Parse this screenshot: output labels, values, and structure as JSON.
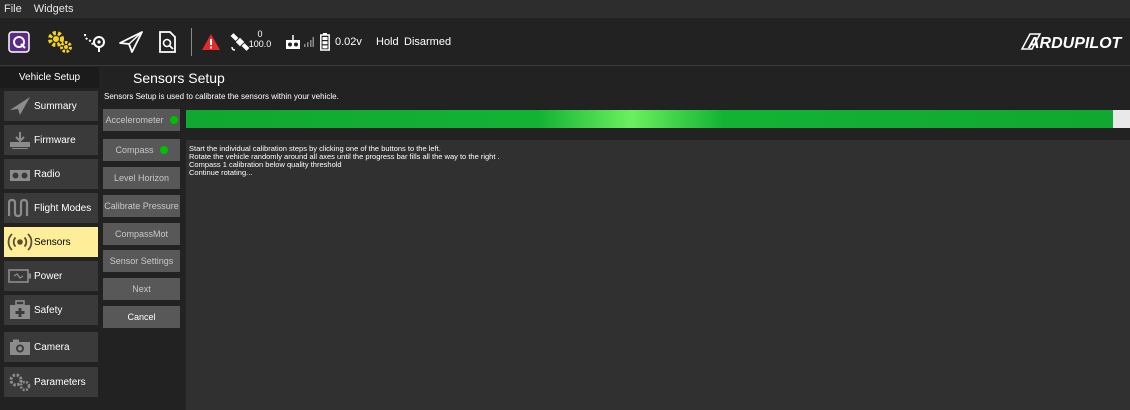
{
  "menubar": {
    "file": "File",
    "widgets": "Widgets"
  },
  "toolbar": {
    "icons": [
      "qgc-logo-icon",
      "vehicle-setup-gear-icon",
      "plan-waypoint-icon",
      "fly-paper-plane-icon",
      "analyze-document-icon",
      "warning-triangle-icon",
      "gps-satellite-icon",
      "rc-transmitter-icon",
      "battery-icon"
    ],
    "gps_count": "0",
    "gps_hdop": "100.0",
    "battery_voltage": "0.02v",
    "flight_mode": "Hold",
    "arm_status": "Disarmed",
    "brand_logo": "ARDUPILOT",
    "warning_color": "#e22a2a",
    "gear_color": "#f5d21e"
  },
  "sidebar": {
    "header": "Vehicle Setup",
    "items": [
      {
        "label": "Summary",
        "icon": "paper-plane-icon",
        "active": false
      },
      {
        "label": "Firmware",
        "icon": "firmware-download-icon",
        "active": false
      },
      {
        "label": "Radio",
        "icon": "radio-transmitter-icon",
        "active": false
      },
      {
        "label": "Flight Modes",
        "icon": "flight-modes-wave-icon",
        "active": false
      },
      {
        "label": "Sensors",
        "icon": "sensors-broadcast-icon",
        "active": true
      },
      {
        "label": "Power",
        "icon": "power-battery-icon",
        "active": false
      },
      {
        "label": "Safety",
        "icon": "safety-medkit-icon",
        "active": false
      },
      {
        "label": "Camera",
        "icon": "camera-icon",
        "active": false
      },
      {
        "label": "Parameters",
        "icon": "parameters-gears-icon",
        "active": false
      }
    ]
  },
  "page": {
    "title": "Sensors Setup",
    "description": "Sensors Setup is used to calibrate the sensors within your vehicle."
  },
  "calibration_buttons": [
    {
      "label": "Accelerometer",
      "status": "complete"
    },
    {
      "label": "Compass",
      "status": "complete"
    },
    {
      "label": "Level Horizon"
    },
    {
      "label": "Calibrate Pressure"
    },
    {
      "label": "CompassMot"
    },
    {
      "label": "Sensor Settings"
    },
    {
      "label": "Next"
    },
    {
      "label": "Cancel"
    }
  ],
  "progress": {
    "fraction": 0.982,
    "color": "#13b235"
  },
  "status_lines": [
    "Start the individual calibration steps by clicking one of the buttons to the left.",
    "Rotate the vehicle randomly around all axes until the progress bar fills all the way to the right .",
    "Compass 1 calibration below quality threshold",
    "Continue rotating..."
  ]
}
